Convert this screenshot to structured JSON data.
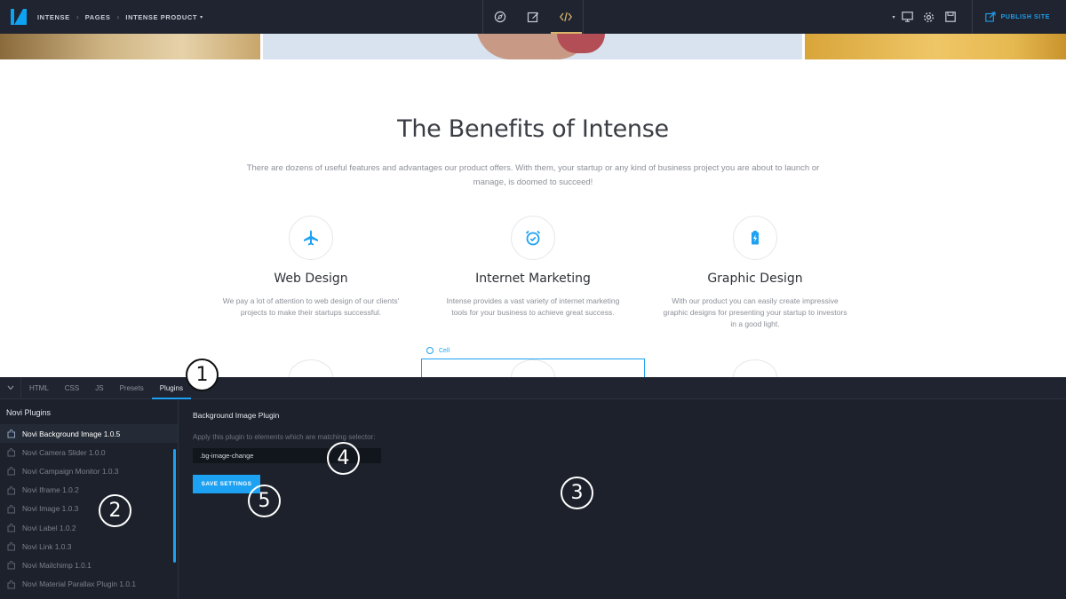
{
  "topbar": {
    "breadcrumbs": [
      "INTENSE",
      "PAGES",
      "INTENSE PRODUCT"
    ],
    "publish_label": "PUBLISH SITE",
    "modes": [
      "navigator-icon",
      "edit-icon",
      "code-icon"
    ],
    "active_mode": "code-icon"
  },
  "content": {
    "title": "The Benefits of Intense",
    "intro": "There are dozens of useful features and advantages our product offers. With them, your startup or any kind of business project you are about to launch or manage, is doomed to succeed!",
    "features": [
      {
        "icon": "airplane-icon",
        "title": "Web Design",
        "text": "We pay a lot of attention to web design of our clients' projects to make their startups successful."
      },
      {
        "icon": "alarm-clock-icon",
        "title": "Internet Marketing",
        "text": "Intense provides a vast variety of internet marketing tools for your business to achieve great success."
      },
      {
        "icon": "battery-icon",
        "title": "Graphic Design",
        "text": "With our product you can easily create impressive graphic designs for presenting your startup to investors in a good light."
      }
    ],
    "cell_label": "Cell"
  },
  "panel": {
    "tabs": [
      "HTML",
      "CSS",
      "JS",
      "Presets",
      "Plugins"
    ],
    "active_tab": "Plugins",
    "list_title": "Novi Plugins",
    "plugins": [
      "Novi Background Image 1.0.5",
      "Novi Camera Slider 1.0.0",
      "Novi Campaign Monitor 1.0.3",
      "Novi Iframe 1.0.2",
      "Novi Image 1.0.3",
      "Novi Label 1.0.2",
      "Novi Link 1.0.3",
      "Novi Mailchimp 1.0.1",
      "Novi Material Parallax Plugin 1.0.1"
    ],
    "selected_plugin": "Novi Background Image 1.0.5",
    "settings": {
      "title": "Background Image Plugin",
      "help": "Apply this plugin to elements which are matching selector:",
      "selector_value": ".bg-image-change",
      "save_label": "SAVE SETTINGS"
    }
  },
  "callouts": [
    "1",
    "2",
    "3",
    "4",
    "5"
  ],
  "colors": {
    "accent": "#1da1f2",
    "topbar": "#1f2430",
    "panel": "#1c212b",
    "active_mode_underline": "#d8b56a"
  }
}
